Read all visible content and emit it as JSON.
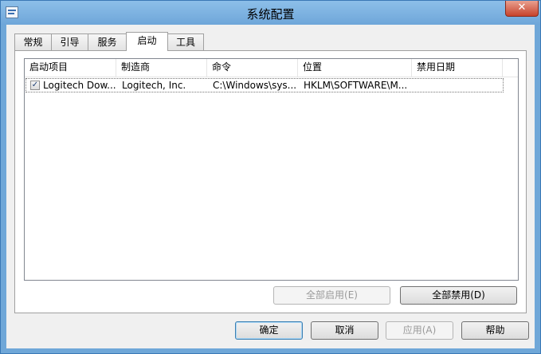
{
  "window": {
    "title": "系统配置"
  },
  "titlebar": {
    "close_glyph": "✕"
  },
  "tabs": [
    {
      "label": "常规"
    },
    {
      "label": "引导"
    },
    {
      "label": "服务"
    },
    {
      "label": "启动"
    },
    {
      "label": "工具"
    }
  ],
  "active_tab": "启动",
  "startup_list": {
    "columns": [
      "启动项目",
      "制造商",
      "命令",
      "位置",
      "禁用日期"
    ],
    "rows": [
      {
        "checked": true,
        "check_glyph": "✓",
        "item": "Logitech Dow...",
        "manufacturer": "Logitech, Inc.",
        "command": "C:\\Windows\\sys...",
        "location": "HKLM\\SOFTWARE\\M...",
        "disable_date": ""
      }
    ]
  },
  "panel_buttons": {
    "enable_all": "全部启用(E)",
    "disable_all": "全部禁用(D)"
  },
  "dialog_buttons": {
    "ok": "确定",
    "cancel": "取消",
    "apply": "应用(A)",
    "help": "帮助"
  },
  "icons": {
    "app": "msconfig-icon",
    "close": "close-icon",
    "checkbox": "checkmark-icon"
  }
}
